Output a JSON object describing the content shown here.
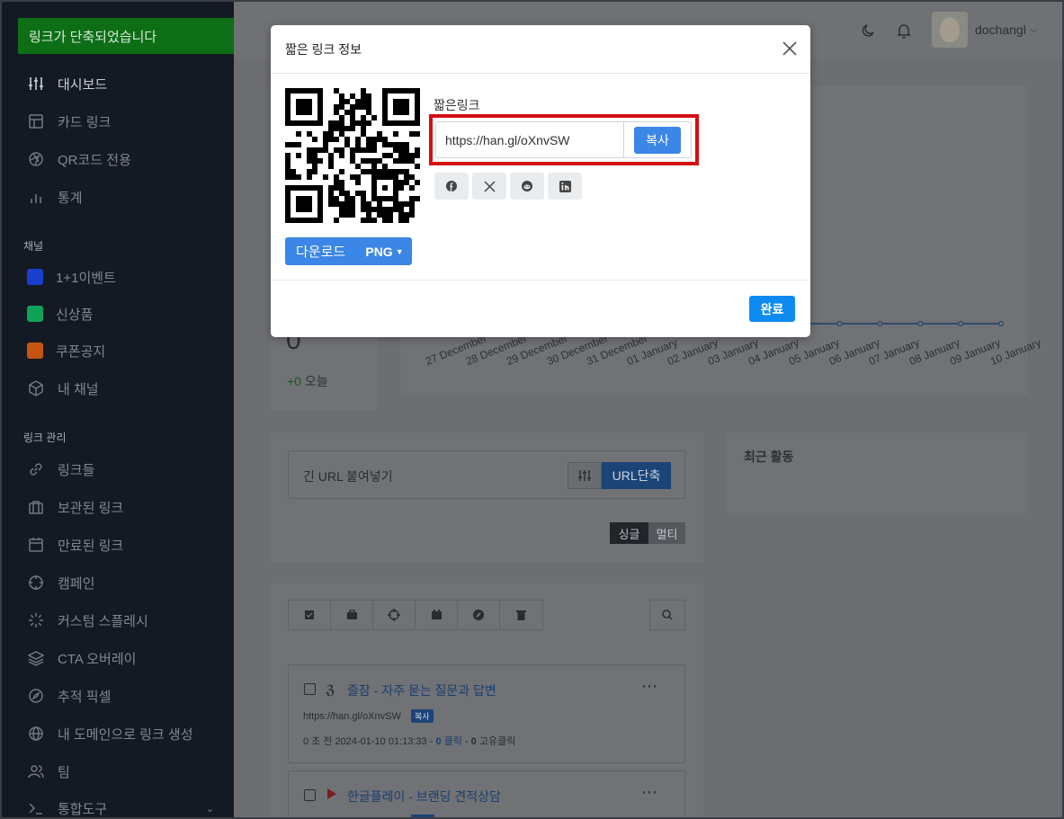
{
  "toast": {
    "text": "링크가 단축되었습니다"
  },
  "sidebar": {
    "items": [
      {
        "label": "대시보드",
        "icon": "sliders-icon"
      },
      {
        "label": "카드 링크",
        "icon": "layout-icon"
      },
      {
        "label": "QR코드 전용",
        "icon": "aperture-icon"
      },
      {
        "label": "통계",
        "icon": "bar-chart-icon"
      }
    ],
    "channels_title": "채널",
    "channels": [
      {
        "label": "1+1이벤트",
        "color": "#1a3fcf"
      },
      {
        "label": "신상품",
        "color": "#0fa35a"
      },
      {
        "label": "쿠폰공지",
        "color": "#c55510"
      },
      {
        "label": "내 채널",
        "icon": "box-icon"
      }
    ],
    "links_title": "링크 관리",
    "links": [
      {
        "label": "링크들",
        "icon": "link-icon"
      },
      {
        "label": "보관된 링크",
        "icon": "briefcase-icon"
      },
      {
        "label": "만료된 링크",
        "icon": "calendar-icon"
      },
      {
        "label": "캠페인",
        "icon": "crosshair-icon"
      },
      {
        "label": "커스텀 스플레시",
        "icon": "loader-icon"
      },
      {
        "label": "CTA 오버레이",
        "icon": "layers-icon"
      },
      {
        "label": "추적 픽셀",
        "icon": "compass-icon"
      },
      {
        "label": "내 도메인으로 링크 생성",
        "icon": "globe-icon"
      },
      {
        "label": "팀",
        "icon": "users-icon"
      },
      {
        "label": "통합도구",
        "icon": "terminal-icon"
      }
    ]
  },
  "header": {
    "username": "dochangl"
  },
  "stats": {
    "count": "0",
    "today_delta": "+0",
    "today_label": "오늘"
  },
  "chart_data": {
    "type": "line",
    "categories": [
      "27 December",
      "28 December",
      "29 December",
      "30 December",
      "31 December",
      "01 January",
      "02 January",
      "03 January",
      "04 January",
      "05 January",
      "06 January",
      "07 January",
      "08 January",
      "09 January",
      "10 January"
    ],
    "values": [
      0,
      0,
      0,
      0,
      0,
      0,
      0,
      0,
      0,
      0,
      0,
      0,
      0,
      0,
      0
    ]
  },
  "shorten": {
    "placeholder": "긴 URL 붙여넣기",
    "button": "URL단축",
    "single": "싱글",
    "multi": "멀티"
  },
  "activity": {
    "title": "최근 활동"
  },
  "list": [
    {
      "title": "즐잠 - 자주 묻는 질문과 답변",
      "url": "https://han.gl/oXnvSW",
      "copy": "복사",
      "meta_prefix": "0 초 전 2024-01-10 01:13:33 - ",
      "clicks": "0",
      "clicks_label": "클릭",
      "unique": "0",
      "unique_label": "고유클릭"
    },
    {
      "title": "한글플레이 - 브랜딩 견적상담"
    }
  ],
  "modal": {
    "title": "짧은 링크 정보",
    "download": "다운로드",
    "format": "PNG",
    "short_label": "짧은링크",
    "short_url": "https://han.gl/oXnvSW",
    "copy": "복사",
    "done": "완료",
    "share": [
      "facebook-icon",
      "x-icon",
      "reddit-icon",
      "linkedin-icon"
    ]
  }
}
